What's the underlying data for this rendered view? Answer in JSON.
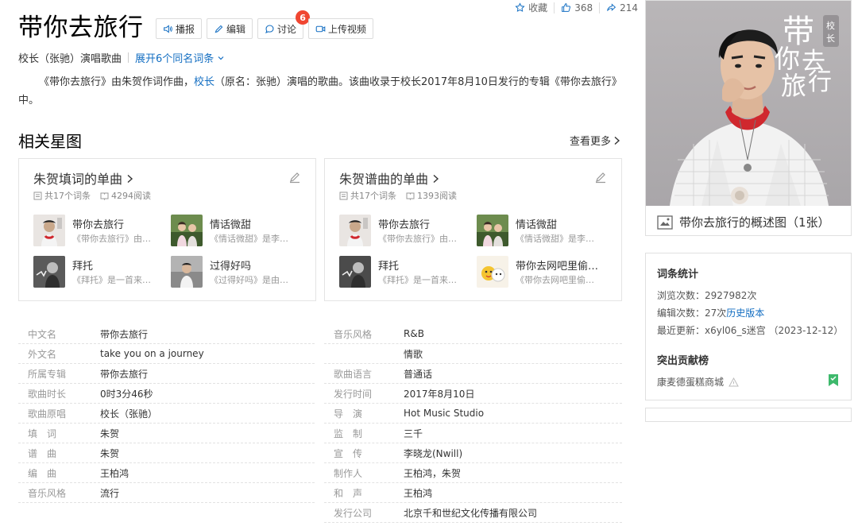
{
  "header": {
    "title": "带你去旅行",
    "buttons": [
      {
        "label": "播报",
        "icon": "speaker-icon"
      },
      {
        "label": "编辑",
        "icon": "pencil-icon"
      },
      {
        "label": "讨论",
        "icon": "chat-bubble-icon",
        "badge": "6"
      },
      {
        "label": "上传视频",
        "icon": "video-icon"
      }
    ],
    "collect_label": "收藏",
    "like_count": "368",
    "share_count": "214",
    "subtitle_singer": "校长（张驰）演唱歌曲",
    "subtitle_expand": "展开6个同名词条"
  },
  "summary": {
    "part1": "《带你去旅行》由朱贺作词作曲，",
    "link": "校长",
    "part2": "（原名：张驰）演唱的歌曲。该曲收录于校长2017年8月10日发行的专辑《带你去旅行》中。"
  },
  "related": {
    "title": "相关星图",
    "more": "查看更多",
    "cards": [
      {
        "title": "朱贺填词的单曲",
        "entries": "共17个词条",
        "reads": "4294阅读",
        "songs": [
          {
            "name": "带你去旅行",
            "desc": "《带你去旅行》由…"
          },
          {
            "name": "情话微甜",
            "desc": "《情话微甜》是李…"
          },
          {
            "name": "拜托",
            "desc": "《拜托》是一首来…"
          },
          {
            "name": "过得好吗",
            "desc": "《过得好吗》是由…"
          }
        ]
      },
      {
        "title": "朱贺谱曲的单曲",
        "entries": "共17个词条",
        "reads": "1393阅读",
        "songs": [
          {
            "name": "带你去旅行",
            "desc": "《带你去旅行》由…"
          },
          {
            "name": "情话微甜",
            "desc": "《情话微甜》是李…"
          },
          {
            "name": "拜托",
            "desc": "《拜托》是一首来…"
          },
          {
            "name": "带你去网吧里偷…",
            "desc": "《带你去网吧里偷…"
          }
        ]
      }
    ]
  },
  "info": {
    "left": [
      {
        "k": "中文名",
        "v": "带你去旅行"
      },
      {
        "k": "外文名",
        "v": "take you on a journey"
      },
      {
        "k": "所属专辑",
        "v": "带你去旅行"
      },
      {
        "k": "歌曲时长",
        "v": "0时3分46秒"
      },
      {
        "k": "歌曲原唱",
        "v": "校长（张驰）"
      },
      {
        "k": "填　词",
        "v": "朱贺"
      },
      {
        "k": "谱　曲",
        "v": "朱贺"
      },
      {
        "k": "编　曲",
        "v": "王柏鸿"
      },
      {
        "k": "音乐风格",
        "v": "流行",
        "link": true
      }
    ],
    "right": [
      {
        "k": "音乐风格",
        "v": "R&B"
      },
      {
        "k": "",
        "v": "情歌",
        "link": true
      },
      {
        "k": "歌曲语言",
        "v": "普通话",
        "link": true
      },
      {
        "k": "发行时间",
        "v": "2017年8月10日"
      },
      {
        "k": "导　演",
        "v": "Hot Music Studio"
      },
      {
        "k": "监　制",
        "v": "三千"
      },
      {
        "k": "宣　传",
        "v": "李晓龙(Nwill)"
      },
      {
        "k": "制作人",
        "v": "王柏鸿，朱贺"
      },
      {
        "k": "和　声",
        "v": "王柏鸿"
      },
      {
        "k": "发行公司",
        "v": "北京千和世纪文化传播有限公司",
        "link": true
      }
    ]
  },
  "sidebar": {
    "cover_caption": "带你去旅行的概述图（1张）",
    "cover_text_main": "带你去旅行",
    "cover_text_tag": "校长",
    "stats_title": "词条统计",
    "views": "浏览次数：2927982次",
    "edits_prefix": "编辑次数：27次",
    "edits_link": "历史版本",
    "last_update": "最近更新：x6yl06_s迷宫 （2023-12-12）",
    "contrib_title": "突出贡献榜",
    "contributor": "康麦德蛋糕商城"
  },
  "colors": {
    "link": "#136ec2",
    "badge": "#f04631",
    "accent_red": "#d0282e"
  }
}
